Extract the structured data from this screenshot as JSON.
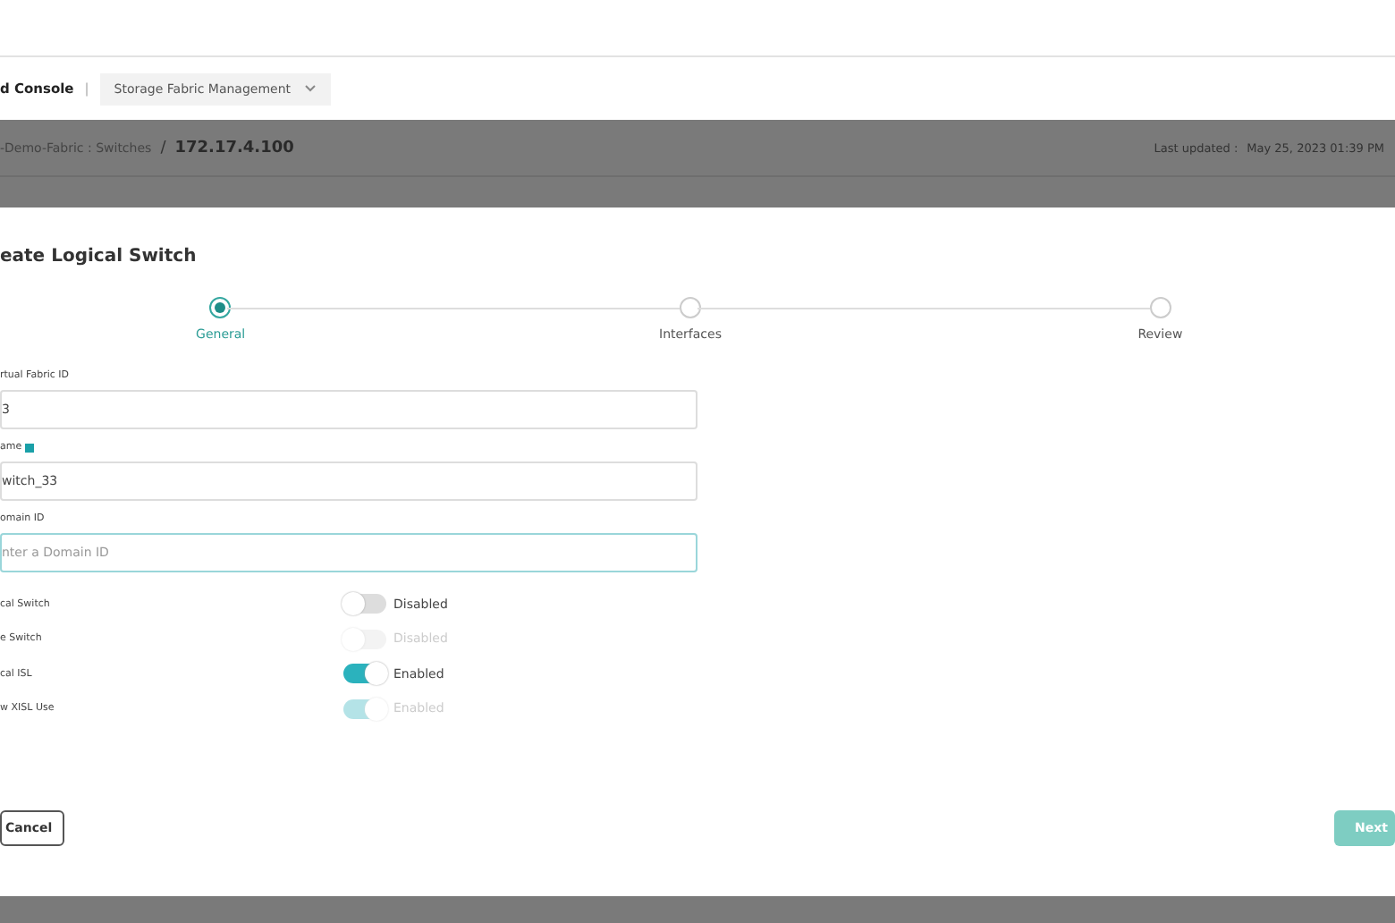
{
  "header": {
    "app_title": "d Console",
    "separator": "|",
    "dropdown": {
      "label": "Storage Fabric Management"
    }
  },
  "breadcrumb": {
    "path": "-Demo-Fabric : Switches",
    "separator": "/",
    "current": "172.17.4.100",
    "last_updated_label": "Last updated :",
    "last_updated_value": "May 25, 2023 01:39 PM"
  },
  "dialog": {
    "title": "eate Logical Switch",
    "steps": [
      {
        "label": "General",
        "selected": true
      },
      {
        "label": "Interfaces",
        "selected": false
      },
      {
        "label": "Review",
        "selected": false
      }
    ],
    "fields": [
      {
        "label": "rtual Fabric ID",
        "value": "3",
        "focused": false,
        "info": false
      },
      {
        "label": "ame",
        "value": "witch_33",
        "focused": false,
        "info": true
      },
      {
        "label": "omain ID",
        "placeholder": "nter a Domain ID",
        "focused": true,
        "info": false
      }
    ],
    "toggles": [
      {
        "label": "cal Switch",
        "on": false,
        "disabled": false,
        "state": "Disabled"
      },
      {
        "label": "e Switch",
        "on": false,
        "disabled": true,
        "state": "Disabled"
      },
      {
        "label": "cal ISL",
        "on": true,
        "disabled": false,
        "state": "Enabled"
      },
      {
        "label": "w XISL Use",
        "on": true,
        "disabled": true,
        "state": "Enabled"
      }
    ],
    "buttons": [
      {
        "label": "Cancel",
        "kind": "secondary"
      },
      {
        "label": "Next",
        "kind": "primary"
      }
    ]
  }
}
